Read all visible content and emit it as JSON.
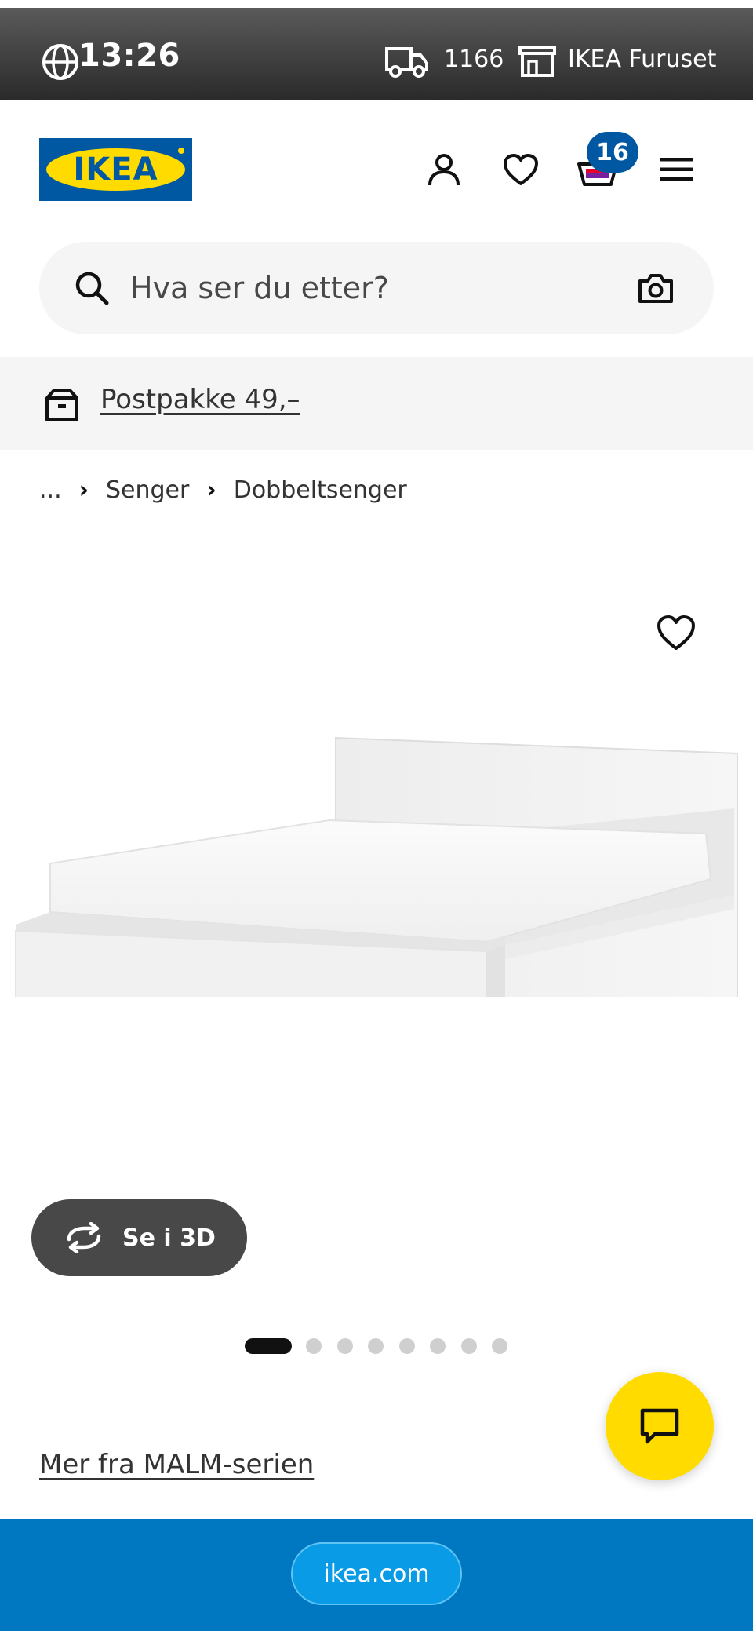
{
  "status_bar": {
    "time": "13:26",
    "delivery_zip": "1166",
    "store_name": "IKEA Furuset"
  },
  "header": {
    "logo_text": "IKEA",
    "cart_count": "16",
    "brand_blue": "#0058a3",
    "brand_yellow": "#ffdb00"
  },
  "search": {
    "placeholder": "Hva ser du etter?"
  },
  "promo": {
    "label": "Postpakke 49,–"
  },
  "breadcrumb": {
    "ellipsis": "...",
    "items": [
      "Senger",
      "Dobbeltsenger"
    ]
  },
  "product": {
    "view_3d_label": "Se i 3D",
    "image_count": 8,
    "active_image_index": 0,
    "series_link": "Mer fra MALM-serien"
  },
  "browser": {
    "url": "ikea.com"
  },
  "icons": {
    "globe": "globe-icon",
    "truck": "truck-icon",
    "store": "store-icon",
    "account": "person-icon",
    "wishlist": "heart-icon",
    "cart": "basket-icon",
    "menu": "hamburger-icon",
    "search": "search-icon",
    "camera": "camera-icon",
    "parcel": "parcel-icon",
    "rotate": "rotate-3d-icon",
    "chat": "chat-icon"
  }
}
